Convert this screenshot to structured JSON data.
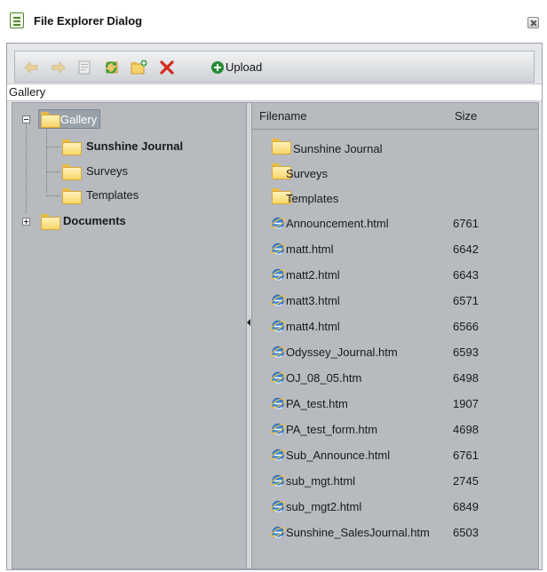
{
  "dialog": {
    "title": "File Explorer Dialog",
    "title_icon": "document-window-icon",
    "close_icon": "close-icon"
  },
  "toolbar": {
    "buttons": [
      {
        "icon": "back-arrow-icon",
        "enabled": false
      },
      {
        "icon": "forward-arrow-icon",
        "enabled": false
      },
      {
        "icon": "properties-icon",
        "enabled": false
      },
      {
        "icon": "refresh-icon",
        "enabled": true
      },
      {
        "icon": "new-folder-icon",
        "enabled": true
      },
      {
        "icon": "delete-icon",
        "enabled": true
      },
      {
        "icon": "upload-icon",
        "enabled": true
      }
    ],
    "upload_label": "Upload"
  },
  "path": "Gallery",
  "tree": {
    "root": {
      "label": "Gallery",
      "expanded": true,
      "selected": true
    },
    "children": [
      {
        "label": "Sunshine Journal",
        "bold": true
      },
      {
        "label": "Surveys"
      },
      {
        "label": "Templates"
      }
    ],
    "documents": {
      "label": "Documents",
      "expanded": false
    }
  },
  "grid": {
    "columns": {
      "filename": "Filename",
      "size": "Size"
    },
    "folders": [
      "Sunshine Journal",
      "Surveys",
      "Templates"
    ],
    "files": [
      {
        "name": "Announcement.html",
        "size": "6761"
      },
      {
        "name": "matt.html",
        "size": "6642"
      },
      {
        "name": "matt2.html",
        "size": "6643"
      },
      {
        "name": "matt3.html",
        "size": "6571"
      },
      {
        "name": "matt4.html",
        "size": "6566"
      },
      {
        "name": "Odyssey_Journal.htm",
        "size": "6593"
      },
      {
        "name": "OJ_08_05.htm",
        "size": "6498"
      },
      {
        "name": "PA_test.htm",
        "size": "1907"
      },
      {
        "name": "PA_test_form.htm",
        "size": "4698"
      },
      {
        "name": "Sub_Announce.html",
        "size": "6761"
      },
      {
        "name": "sub_mgt.html",
        "size": "2745"
      },
      {
        "name": "sub_mgt2.html",
        "size": "6849"
      },
      {
        "name": "Sunshine_SalesJournal.htm",
        "size": "6503"
      }
    ]
  },
  "colors": {
    "pane_bg": "#b7babf",
    "toolbar_bg": "#dfe1e4",
    "selection_bg": "#99a2ab",
    "folder": "#f7d56a",
    "ie_blue": "#2a6fc9"
  }
}
